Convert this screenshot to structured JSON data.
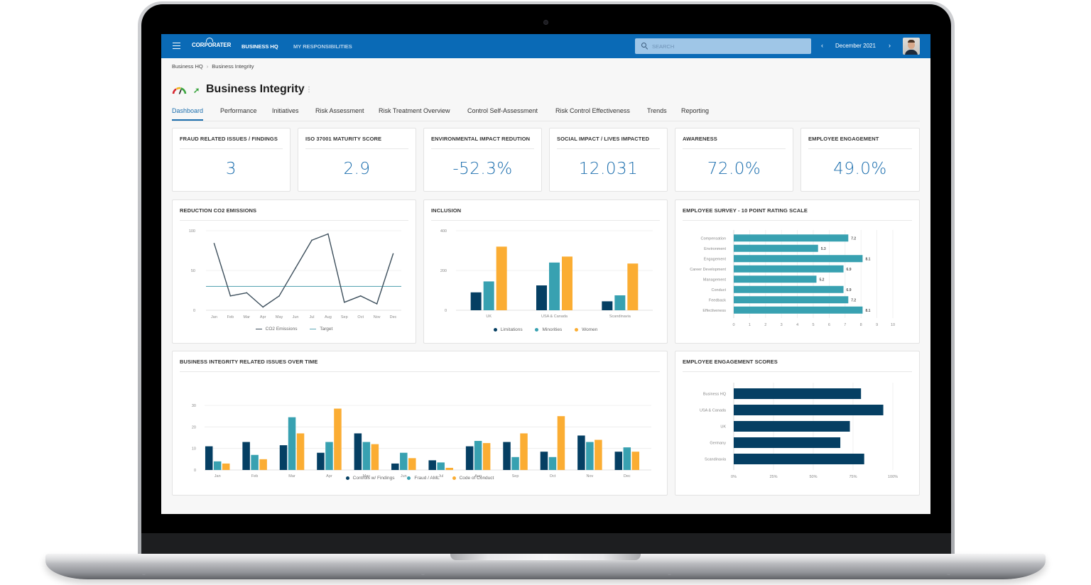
{
  "app": {
    "logo": "CORPORATER",
    "nav": [
      {
        "label": "BUSINESS HQ",
        "active": true
      },
      {
        "label": "MY RESPONSIBILITIES",
        "active": false
      }
    ],
    "search_placeholder": "SEARCH",
    "period": "December 2021",
    "prev_icon": "‹",
    "next_icon": "›"
  },
  "breadcrumb": [
    "Business HQ",
    "Business Integrity"
  ],
  "breadcrumb_sep": "›",
  "page": {
    "title": "Business Integrity",
    "kebab": "⋮",
    "trend_icon": "➚"
  },
  "tabs": [
    {
      "label": "Dashboard",
      "active": true
    },
    {
      "label": "Performance"
    },
    {
      "label": "Initiatives"
    },
    {
      "label": "Risk Assessment"
    },
    {
      "label": "Risk Treatment Overview"
    },
    {
      "label": "Control Self-Assessment"
    },
    {
      "label": "Risk Control Effectiveness"
    },
    {
      "label": "Trends"
    },
    {
      "label": "Reporting"
    }
  ],
  "kpis": [
    {
      "title": "FRAUD RELATED ISSUES / FINDINGS",
      "value": "3"
    },
    {
      "title": "ISO 37001 MATURITY SCORE",
      "value": "2.9"
    },
    {
      "title": "ENVIRONMENTAL IMPACT REDUTION",
      "value": "-52.3%"
    },
    {
      "title": "SOCIAL IMPACT / LIVES IMPACTED",
      "value": "12.031"
    },
    {
      "title": "AWARENESS",
      "value": "72.0%"
    },
    {
      "title": "EMPLOYEE ENGAGEMENT",
      "value": "49.0%"
    }
  ],
  "colors": {
    "brand": "#0a6ab6",
    "accent": "#1d6fae",
    "navy": "#053f63",
    "teal": "#38a1b1",
    "orange": "#fbad33",
    "line": "#3d4f5c",
    "target": "#5fa8b6"
  },
  "chart_data": [
    {
      "id": "co2",
      "type": "line",
      "title": "REDUCTION CO2 EMISSIONS",
      "categories": [
        "Jan",
        "Feb",
        "Mar",
        "Apr",
        "May",
        "Jun",
        "Jul",
        "Aug",
        "Sep",
        "Oct",
        "Nov",
        "Dec"
      ],
      "series": [
        {
          "name": "CO2 Emissions",
          "values": [
            84,
            18,
            22,
            4,
            18,
            53,
            88,
            96,
            10,
            18,
            8,
            71
          ]
        },
        {
          "name": "Target",
          "values": [
            30,
            30,
            30,
            30,
            30,
            30,
            30,
            30,
            30,
            30,
            30,
            30
          ]
        }
      ],
      "yticks": [
        0,
        50,
        100
      ],
      "ylim": [
        0,
        100
      ],
      "grid": true,
      "legend": "bottom"
    },
    {
      "id": "inclusion",
      "type": "bar",
      "title": "INCLUSION",
      "categories": [
        "UK",
        "USA & Canada",
        "Scandinavia"
      ],
      "series": [
        {
          "name": "Limitations",
          "values": [
            90,
            125,
            45
          ]
        },
        {
          "name": "Minorities",
          "values": [
            145,
            240,
            75
          ]
        },
        {
          "name": "Women",
          "values": [
            320,
            270,
            235
          ]
        }
      ],
      "yticks": [
        0,
        200,
        400
      ],
      "ylim": [
        0,
        400
      ],
      "grid": true,
      "legend": "bottom"
    },
    {
      "id": "survey",
      "type": "bar",
      "orientation": "horizontal",
      "title": "EMPLOYEE SURVEY - 10 POINT RATING SCALE",
      "categories": [
        "Compensation",
        "Environment",
        "Engagement",
        "Career Development",
        "Management",
        "Conduct",
        "Feedback",
        "Effectiveness"
      ],
      "values": [
        7.2,
        5.3,
        8.1,
        6.9,
        5.2,
        6.9,
        7.2,
        8.1
      ],
      "data_labels": [
        "7.2",
        "5.3",
        "8.1",
        "6.9",
        "5.2",
        "6.9",
        "7.2",
        "8.1"
      ],
      "xticks": [
        0,
        1,
        2,
        3,
        4,
        5,
        6,
        7,
        8,
        9,
        10
      ],
      "xlim": [
        0,
        10
      ],
      "grid": true
    },
    {
      "id": "issues",
      "type": "bar",
      "title": "BUSINESS INTEGRITY RELATED ISSUES OVER TIME",
      "categories": [
        "Jan",
        "Feb",
        "Mar",
        "Apr",
        "May",
        "Jun",
        "Jul",
        "Aug",
        "Sep",
        "Oct",
        "Nov",
        "Dec"
      ],
      "series": [
        {
          "name": "Controls w/ Findings",
          "values": [
            11,
            13,
            11.5,
            8,
            17,
            3,
            4.5,
            11,
            13,
            8.5,
            16,
            8.5
          ]
        },
        {
          "name": "Fraud / AML",
          "values": [
            4,
            7,
            24.5,
            13,
            13,
            8,
            3.5,
            13.5,
            6,
            6,
            13,
            10.5
          ]
        },
        {
          "name": "Code of Conduct",
          "values": [
            3,
            5,
            17,
            28.5,
            12,
            5.5,
            1,
            12.5,
            17,
            25,
            14,
            8.5
          ]
        }
      ],
      "yticks": [
        0,
        10,
        20,
        30
      ],
      "ylim": [
        0,
        30
      ],
      "grid": true,
      "legend": "bottom"
    },
    {
      "id": "engagement",
      "type": "bar",
      "orientation": "horizontal",
      "title": "EMPLOYEE ENGAGEMENT SCORES",
      "categories": [
        "Business HQ",
        "USA & Canada",
        "UK",
        "Germany",
        "Scandinavia"
      ],
      "values": [
        80,
        94,
        73,
        67,
        82
      ],
      "xticks": [
        "0%",
        "25%",
        "50%",
        "75%",
        "100%"
      ],
      "xlim": [
        0,
        100
      ],
      "grid": true
    }
  ]
}
